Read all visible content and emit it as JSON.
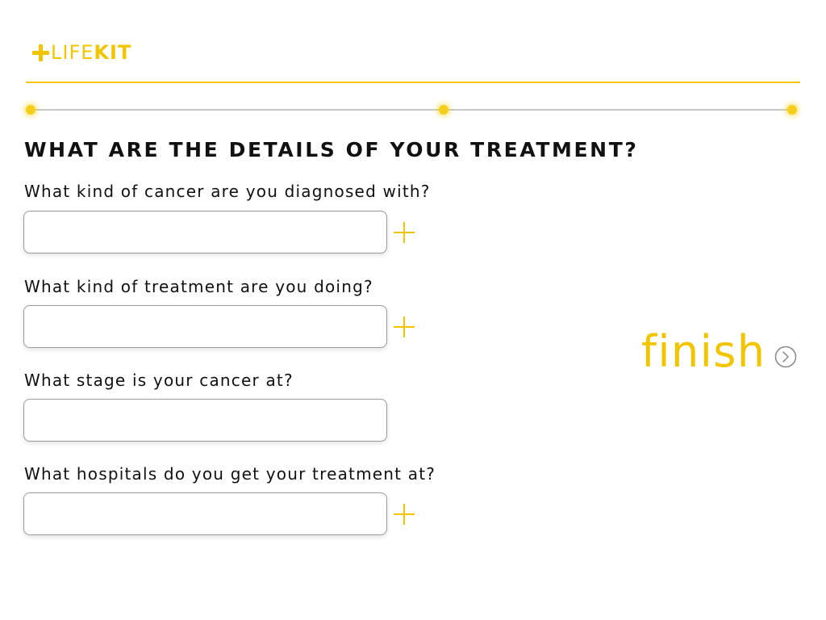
{
  "brand": {
    "logo_part1": "LIFE",
    "logo_part2": "KIT",
    "accent_color": "#f2c500"
  },
  "progress": {
    "steps": 3,
    "active_step": 3
  },
  "form": {
    "heading": "WHAT ARE THE DETAILS OF YOUR TREATMENT?",
    "questions": [
      {
        "label": "What kind of cancer are you diagnosed with?",
        "value": "",
        "placeholder": "",
        "has_add": true
      },
      {
        "label": "What kind of treatment are you doing?",
        "value": "",
        "placeholder": "",
        "has_add": true
      },
      {
        "label": "What stage is your cancer at?",
        "value": "",
        "placeholder": "",
        "has_add": false
      },
      {
        "label": "What hospitals do you get your treatment at?",
        "value": "",
        "placeholder": "",
        "has_add": true
      }
    ]
  },
  "actions": {
    "finish_label": "finish",
    "finish_icon": "chevron-right-circle-icon",
    "add_icon": "plus-icon"
  }
}
